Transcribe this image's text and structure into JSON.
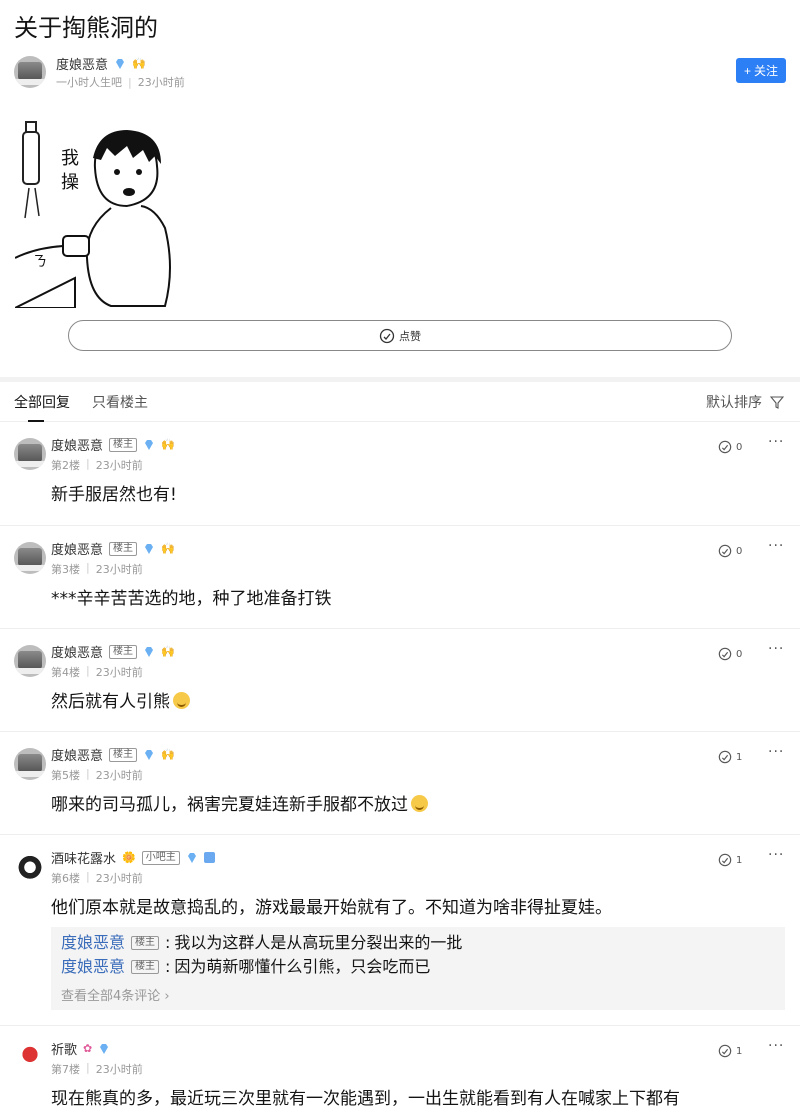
{
  "post": {
    "title": "关于掏熊洞的",
    "author": {
      "name": "度娘恶意",
      "bar": "一小时人生吧",
      "time": "23小时前"
    },
    "follow_label": "关注",
    "image_text": "我操",
    "like_label": "点赞"
  },
  "tabs": {
    "all": "全部回复",
    "op_only": "只看楼主",
    "sort": "默认排序"
  },
  "replies": [
    {
      "name": "度娘恶意",
      "badge": "楼主",
      "floor": "第2楼",
      "time": "23小时前",
      "text": "新手服居然也有!",
      "likes": "0"
    },
    {
      "name": "度娘恶意",
      "badge": "楼主",
      "floor": "第3楼",
      "time": "23小时前",
      "text": "***辛辛苦苦选的地，种了地准备打铁",
      "likes": "0"
    },
    {
      "name": "度娘恶意",
      "badge": "楼主",
      "floor": "第4楼",
      "time": "23小时前",
      "text": "然后就有人引熊",
      "likes": "0"
    },
    {
      "name": "度娘恶意",
      "badge": "楼主",
      "floor": "第5楼",
      "time": "23小时前",
      "text": "哪来的司马孤儿，祸害完夏娃连新手服都不放过",
      "likes": "1"
    },
    {
      "name": "酒味花露水",
      "badge": "小吧主",
      "floor": "第6楼",
      "time": "23小时前",
      "text": "他们原本就是故意捣乱的，游戏最最开始就有了。不知道为啥非得扯夏娃。",
      "likes": "1",
      "sub": [
        {
          "name": "度娘恶意",
          "badge": "楼主",
          "text": "我以为这群人是从高玩里分裂出来的一批"
        },
        {
          "name": "度娘恶意",
          "badge": "楼主",
          "text": "因为萌新哪懂什么引熊，只会吃而已"
        }
      ],
      "view_all": "查看全部4条评论"
    },
    {
      "name": "祈歌",
      "floor": "第7楼",
      "time": "23小时前",
      "text": "现在熊真的多，最近玩三次里就有一次能遇到，一出生就能看到有人在喊家上下都有",
      "likes": "1"
    }
  ],
  "colors": {
    "accent": "#2d7ff5",
    "sub_name": "#3b6dba"
  }
}
